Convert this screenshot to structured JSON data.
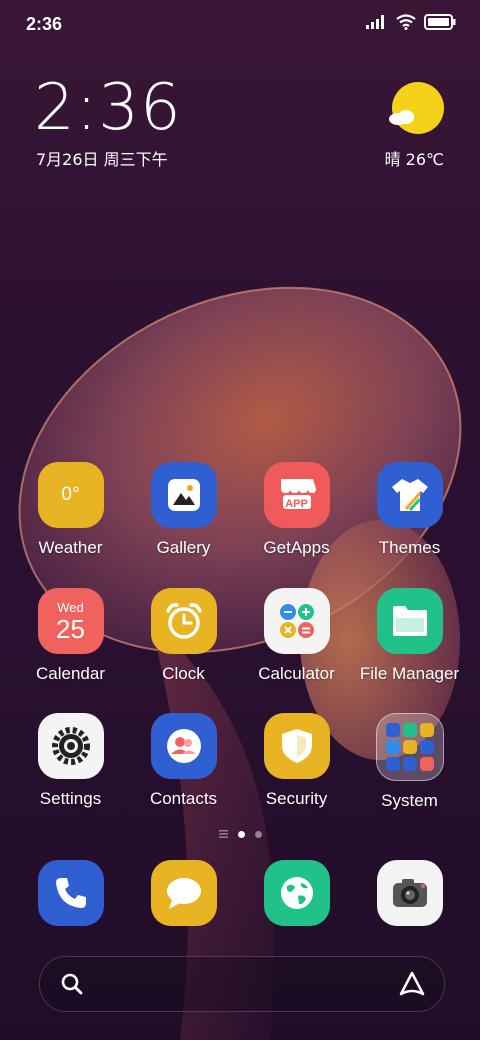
{
  "status": {
    "time": "2:36"
  },
  "lock_widget": {
    "time": "2:36",
    "date": "7月26日 周三下午",
    "weather": "晴 26℃"
  },
  "apps": [
    {
      "label": "Weather",
      "value": "0°"
    },
    {
      "label": "Gallery"
    },
    {
      "label": "GetApps",
      "badge": "APP"
    },
    {
      "label": "Themes"
    },
    {
      "label": "Calendar",
      "day": "Wed",
      "date": "25"
    },
    {
      "label": "Clock"
    },
    {
      "label": "Calculator"
    },
    {
      "label": "File Manager"
    },
    {
      "label": "Settings"
    },
    {
      "label": "Contacts"
    },
    {
      "label": "Security"
    },
    {
      "label": "System"
    }
  ],
  "dock": [
    {
      "name": "phone-icon"
    },
    {
      "name": "messages-icon"
    },
    {
      "name": "browser-icon"
    },
    {
      "name": "camera-icon"
    }
  ],
  "colors": {
    "weather": "#e8b423",
    "gallery": "#2f5fd0",
    "getapps": "#f05a5a",
    "themes": "#2f5fd0",
    "calendar": "#f0625e",
    "clock": "#e8b423",
    "calculator": "#f4f4f4",
    "filemanager": "#20c28a",
    "settings": "#f4f4f4",
    "contacts": "#2f5fd0",
    "security": "#e8b423",
    "phone": "#2f5fd0",
    "messages": "#e8b423",
    "browser": "#20c28a",
    "camera": "#f4f4f4"
  }
}
